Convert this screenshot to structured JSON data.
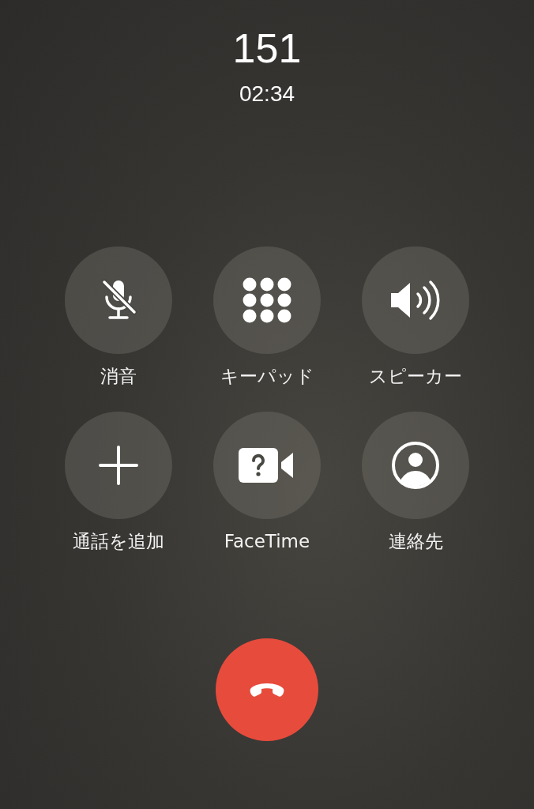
{
  "call": {
    "number": "151",
    "duration": "02:34"
  },
  "controls": [
    {
      "label": "消音",
      "kind": "mute"
    },
    {
      "label": "キーパッド",
      "kind": "keypad"
    },
    {
      "label": "スピーカー",
      "kind": "speaker"
    },
    {
      "label": "通話を追加",
      "kind": "add"
    },
    {
      "label": "FaceTime",
      "kind": "facetime"
    },
    {
      "label": "連絡先",
      "kind": "contacts"
    }
  ],
  "end_call": {
    "kind": "end"
  }
}
